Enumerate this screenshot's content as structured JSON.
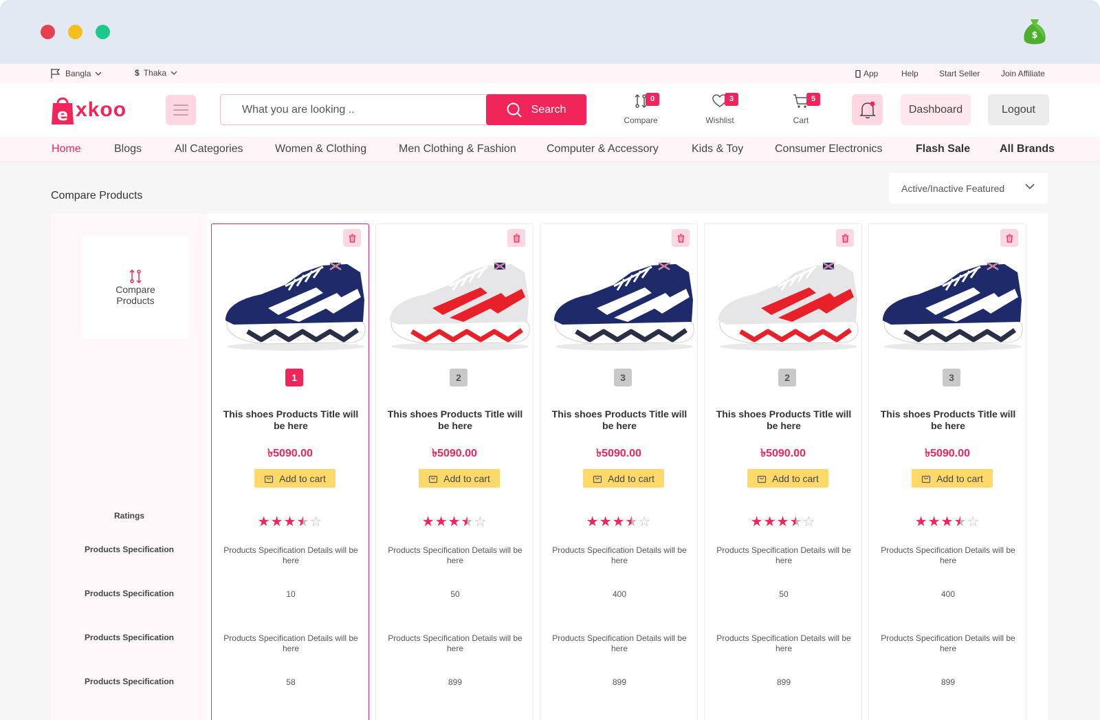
{
  "topbar": {
    "language": "Bangla",
    "currency": "Thaka",
    "currency_symbol": "$",
    "links": [
      "App",
      "Help",
      "Start Seller",
      "Join Affiliate"
    ]
  },
  "header": {
    "logo_text": "xkoo",
    "search_placeholder": "What you are looking ..",
    "search_button": "Search",
    "compare": {
      "label": "Compare",
      "count": "0"
    },
    "wishlist": {
      "label": "Wishlist",
      "count": "3"
    },
    "cart": {
      "label": "Cart",
      "count": "5"
    },
    "dashboard": "Dashboard",
    "logout": "Logout"
  },
  "nav": [
    "Home",
    "Blogs",
    "All Categories",
    "Women & Clothing",
    "Men Clothing & Fashion",
    "Computer & Accessory",
    "Kids & Toy",
    "Consumer Electronics",
    "Flash Sale",
    "All Brands"
  ],
  "page": {
    "title": "Compare Products",
    "filter": "Active/Inactive Featured",
    "compare_card": [
      "Compare",
      "Products"
    ],
    "row_labels": [
      "Ratings",
      "Products Specification",
      "Products Specification",
      "Products Specification",
      "Products Specification"
    ]
  },
  "products": [
    {
      "num": "1",
      "shoe": "navy",
      "title": "This shoes Products Title will be here",
      "price": "৳5090.00",
      "cart": "Add to cart",
      "rating": 3.5,
      "spec1": "Products Specification Details will be here",
      "spec2": "10",
      "spec3": "Products Specification Details will be here",
      "spec4": "58"
    },
    {
      "num": "2",
      "shoe": "white",
      "title": "This shoes Products Title will be here",
      "price": "৳5090.00",
      "cart": "Add to cart",
      "rating": 3.5,
      "spec1": "Products Specification Details will be here",
      "spec2": "50",
      "spec3": "Products Specification Details will be here",
      "spec4": "899"
    },
    {
      "num": "3",
      "shoe": "navy",
      "title": "This shoes Products Title will be here",
      "price": "৳5090.00",
      "cart": "Add to cart",
      "rating": 3.5,
      "spec1": "Products Specification Details will be here",
      "spec2": "400",
      "spec3": "Products Specification Details will be here",
      "spec4": "899"
    },
    {
      "num": "2",
      "shoe": "white",
      "title": "This shoes Products Title will be here",
      "price": "৳5090.00",
      "cart": "Add to cart",
      "rating": 3.5,
      "spec1": "Products Specification Details will be here",
      "spec2": "50",
      "spec3": "Products Specification Details will be here",
      "spec4": "899"
    },
    {
      "num": "3",
      "shoe": "navy",
      "title": "This shoes Products Title will be here",
      "price": "৳5090.00",
      "cart": "Add to cart",
      "rating": 3.5,
      "spec1": "Products Specification Details will be here",
      "spec2": "400",
      "spec3": "Products Specification Details will be here",
      "spec4": "899"
    }
  ],
  "colors": {
    "accent": "#f2255b",
    "cart_button": "#ffda6b",
    "navy_shoe": "#1f2a6b",
    "red_shoe": "#e8202a"
  }
}
